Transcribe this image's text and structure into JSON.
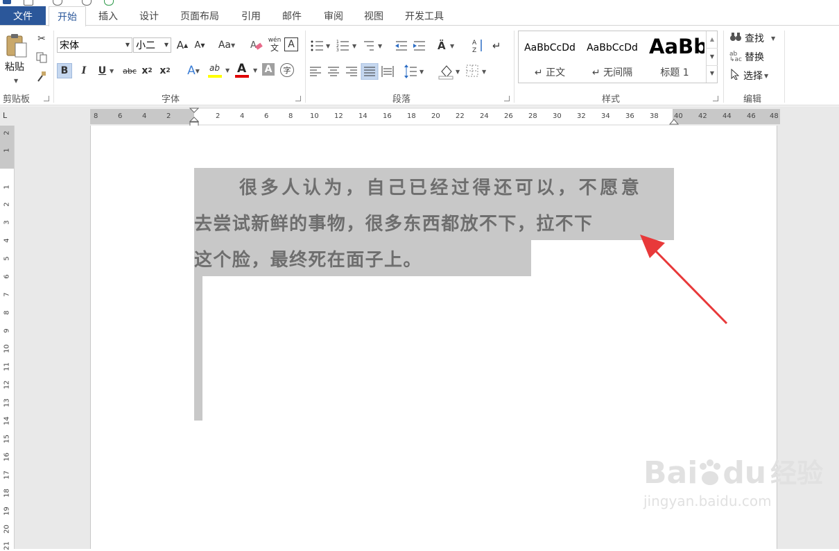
{
  "tabs": {
    "file": "文件",
    "items": [
      "开始",
      "插入",
      "设计",
      "页面布局",
      "引用",
      "邮件",
      "审阅",
      "视图",
      "开发工具"
    ]
  },
  "clipboard": {
    "paste": "粘贴",
    "group_label": "剪贴板"
  },
  "font": {
    "name": "宋体",
    "size": "小二",
    "group_label": "字体",
    "grow": "A",
    "shrink": "A",
    "case": "Aa",
    "phonetic_top": "wén",
    "phonetic_bottom": "文",
    "border_char": "A",
    "bold": "B",
    "italic": "I",
    "underline": "U",
    "strike": "abc",
    "subscript": "x",
    "subscript_mark": "2",
    "superscript": "x",
    "superscript_mark": "2",
    "effects": "A",
    "highlight": "ab",
    "color": "A",
    "shading": "A",
    "enclose": "字"
  },
  "paragraph": {
    "group_label": "段落"
  },
  "styles": {
    "group_label": "样式",
    "items": [
      {
        "preview": "AaBbCcDd",
        "name": "↵ 正文"
      },
      {
        "preview": "AaBbCcDd",
        "name": "↵ 无间隔"
      },
      {
        "preview": "AaBb",
        "name": "标题 1"
      }
    ]
  },
  "editing": {
    "group_label": "编辑",
    "find": "查找",
    "replace": "替换",
    "select": "选择"
  },
  "ruler": {
    "tab_selector": "L",
    "left_numbers": [
      "8",
      "6",
      "4",
      "2"
    ],
    "right_numbers": [
      "2",
      "4",
      "6",
      "8",
      "10",
      "12",
      "14",
      "16",
      "18",
      "20",
      "22",
      "24",
      "26",
      "28",
      "30",
      "32",
      "34",
      "36",
      "38",
      "40",
      "42",
      "44",
      "46",
      "48"
    ],
    "vertical_numbers": [
      "2",
      "1",
      "1",
      "2",
      "3",
      "4",
      "5",
      "6",
      "7",
      "8",
      "9",
      "10",
      "11",
      "12",
      "13",
      "14",
      "15",
      "16",
      "17",
      "18",
      "19",
      "20",
      "21"
    ]
  },
  "document": {
    "lines": [
      "很多人认为，自己已经过得还可以，不愿意",
      "去尝试新鲜的事物，很多东西都放不下，拉不下",
      "这个脸，最终死在面子上。"
    ]
  },
  "watermark": {
    "brand": "Bai",
    "brand2": "du",
    "cn": "经验",
    "url": "jingyan.baidu.com"
  },
  "colors": {
    "accent": "#2b579a",
    "highlight": "#c8c8c8",
    "arrow": "#e8393a",
    "font_color_bar": "#e00000",
    "highlight_bar": "#ffff00"
  }
}
